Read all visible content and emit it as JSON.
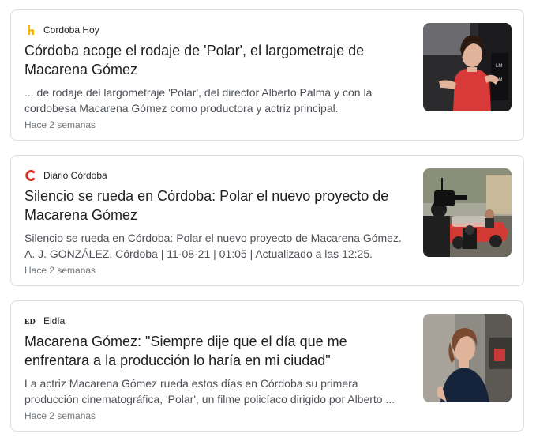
{
  "articles": [
    {
      "source": "Cordoba Hoy",
      "source_icon": "cordoba-hoy-favicon",
      "source_color": "#f4b400",
      "title": "Córdoba acoge el rodaje de 'Polar', el largometraje de Macarena Gómez",
      "snippet": "... de rodaje del largometraje 'Polar', del director Alberto Palma y con la cordobesa Macarena Gómez como productora y actriz principal.",
      "time": "Hace 2 semanas",
      "thumbnail": "woman-in-red-dress-photo"
    },
    {
      "source": "Diario Córdoba",
      "source_icon": "diario-cordoba-favicon",
      "source_color": "#d93025",
      "title": "Silencio se rueda en Córdoba: Polar el nuevo proyecto de Macarena Gómez",
      "snippet": "Silencio se rueda en Córdoba: Polar el nuevo proyecto de Macarena Gómez. A. J. GONZÁLEZ. Córdoba | 11·08·21 | 01:05 | Actualizado a las 12:25.",
      "time": "Hace 2 semanas",
      "thumbnail": "film-crew-red-car-photo"
    },
    {
      "source": "Eldía",
      "source_icon_text": "ED",
      "source_icon": "eldia-favicon",
      "title": "Macarena Gómez: \"Siempre dije que el día que me enfrentara a la producción lo haría en mi ciudad\"",
      "snippet": "La actriz Macarena Gómez rueda estos días en Córdoba su primera producción cinematográfica, 'Polar', un filme policíaco dirigido por Alberto ...",
      "time": "Hace 2 semanas",
      "thumbnail": "woman-outdoor-portrait-photo"
    }
  ]
}
